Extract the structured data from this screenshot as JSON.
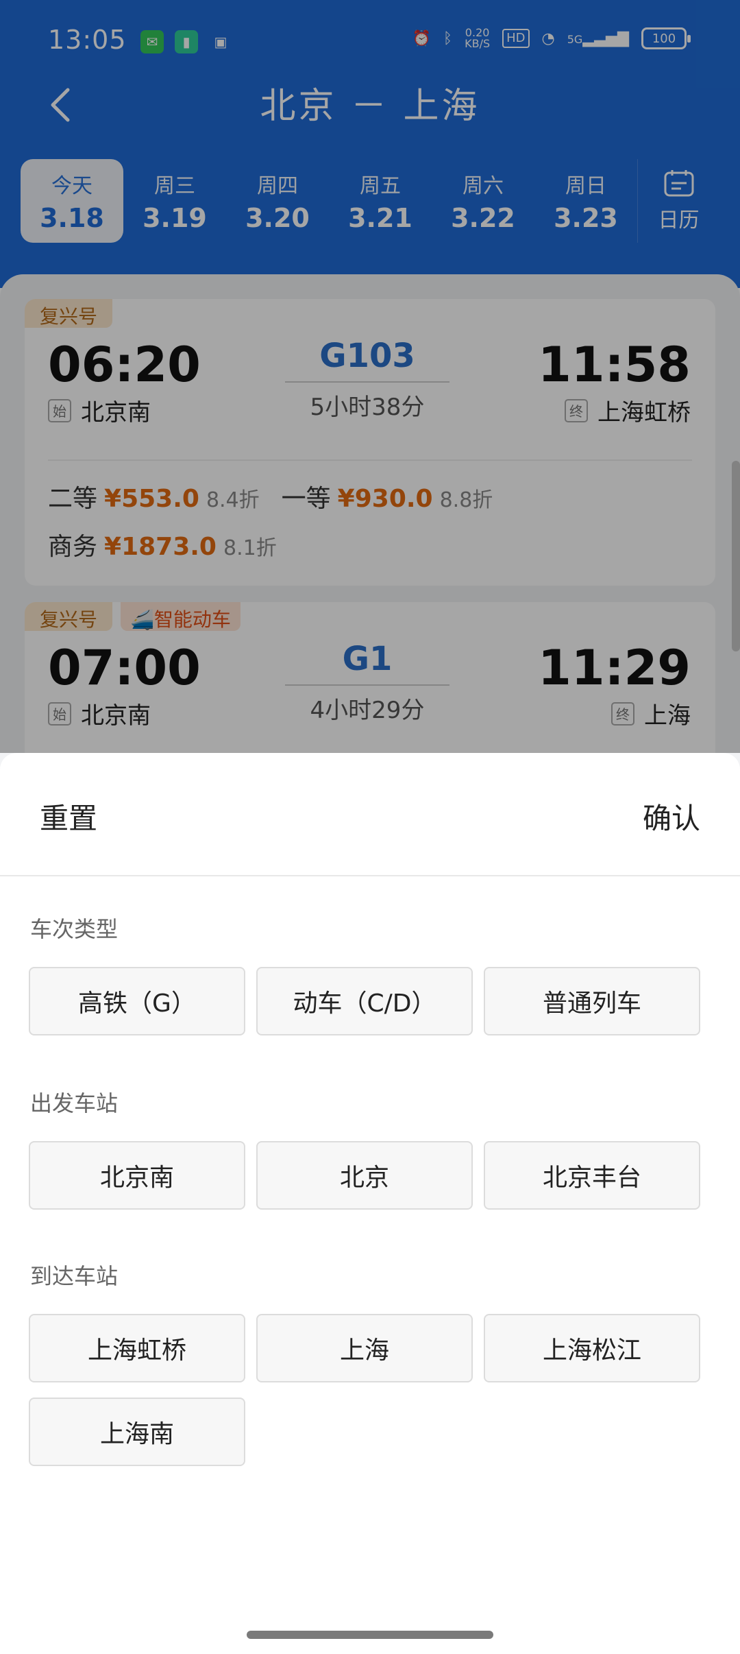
{
  "status": {
    "time": "13:05",
    "netspeed_value": "0.20",
    "netspeed_unit": "KB/S",
    "hd": "HD",
    "network": "5G",
    "battery": "100"
  },
  "nav": {
    "title": "北京 － 上海"
  },
  "dates": [
    {
      "weekday": "今天",
      "date": "3.18",
      "active": true
    },
    {
      "weekday": "周三",
      "date": "3.19"
    },
    {
      "weekday": "周四",
      "date": "3.20"
    },
    {
      "weekday": "周五",
      "date": "3.21"
    },
    {
      "weekday": "周六",
      "date": "3.22"
    },
    {
      "weekday": "周日",
      "date": "3.23"
    }
  ],
  "calendar_label": "日历",
  "trains": [
    {
      "tags": [
        "复兴号"
      ],
      "dep_time": "06:20",
      "train_no": "G103",
      "duration": "5小时38分",
      "arr_time": "11:58",
      "dep_badge": "始",
      "dep_station": "北京南",
      "arr_badge": "终",
      "arr_station": "上海虹桥",
      "prices": [
        {
          "class": "二等",
          "price": "¥553.0",
          "discount": "8.4折"
        },
        {
          "class": "一等",
          "price": "¥930.0",
          "discount": "8.8折"
        },
        {
          "class": "商务",
          "price": "¥1873.0",
          "discount": "8.1折"
        }
      ]
    },
    {
      "tags": [
        "复兴号",
        "智能动车"
      ],
      "dep_time": "07:00",
      "train_no": "G1",
      "duration": "4小时29分",
      "arr_time": "11:29",
      "dep_badge": "始",
      "dep_station": "北京南",
      "arr_badge": "终",
      "arr_station": "上海"
    }
  ],
  "sheet": {
    "reset": "重置",
    "confirm": "确认",
    "train_type": {
      "title": "车次类型",
      "options": [
        "高铁（G）",
        "动车（C/D）",
        "普通列车"
      ]
    },
    "departure": {
      "title": "出发车站",
      "options": [
        "北京南",
        "北京",
        "北京丰台"
      ]
    },
    "arrival": {
      "title": "到达车站",
      "options": [
        "上海虹桥",
        "上海",
        "上海松江",
        "上海南"
      ]
    }
  },
  "colors": {
    "primary": "#1f6bd6",
    "price": "#e26a12",
    "tag_bg": "#fbe6cc",
    "tag_text": "#b3691a"
  }
}
